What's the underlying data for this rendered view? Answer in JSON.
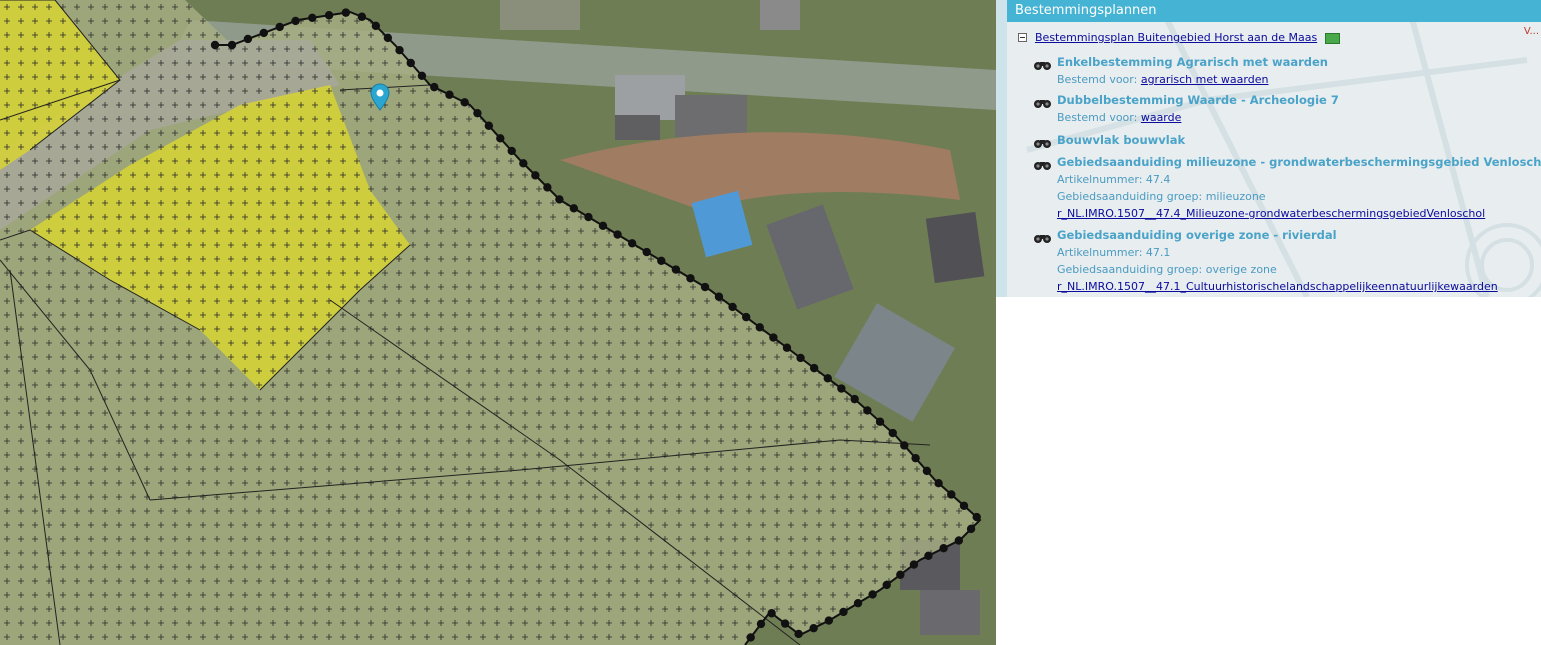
{
  "panel": {
    "title": "Bestemmingsplannen",
    "corner_mark": "V...",
    "plan_name": "Bestemmingsplan Buitengebied Horst aan de Maas",
    "entries": [
      {
        "title": "Enkelbestemming Agrarisch met waarden",
        "lines": [
          {
            "label": "Bestemd voor:",
            "link": "agrarisch met waarden"
          }
        ]
      },
      {
        "title": "Dubbelbestemming Waarde - Archeologie 7",
        "lines": [
          {
            "label": "Bestemd voor:",
            "link": "waarde"
          }
        ]
      },
      {
        "title": "Bouwvlak bouwvlak",
        "lines": []
      },
      {
        "title": "Gebiedsaanduiding milieuzone - grondwaterbeschermingsgebied Venloschol",
        "lines": [
          {
            "label": "Artikelnummer: 47.4"
          },
          {
            "label": "Gebiedsaanduiding groep: milieuzone"
          },
          {
            "link": "r_NL.IMRO.1507__47.4_Milieuzone-grondwaterbeschermingsgebiedVenloschol"
          }
        ]
      },
      {
        "title": "Gebiedsaanduiding overige zone - rivierdal",
        "lines": [
          {
            "label": "Artikelnummer: 47.1"
          },
          {
            "label": "Gebiedsaanduiding groep: overige zone"
          },
          {
            "link": "r_NL.IMRO.1507__47.1_Cultuurhistorischelandschappelijkeennatuurlijkewaarden"
          }
        ]
      }
    ]
  },
  "map": {
    "marker_icon": "map-pin-icon",
    "entry_icon": "binoculars-icon",
    "colors": {
      "overlay_green": "#a7ae83",
      "yellow_zone": "#d9d530",
      "road": "#8f9a8a",
      "boundary": "#111111",
      "marker": "#2aa6d1",
      "panel_header": "#45b3d3"
    }
  }
}
